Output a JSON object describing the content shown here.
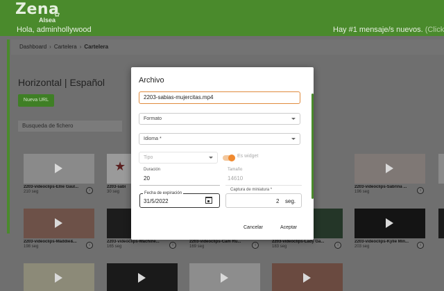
{
  "header": {
    "logo": "Zena",
    "logo_sub": "Alsea",
    "greeting": "Hola, adminhollywood",
    "messages": "Hay #1 mensaje/s nuevos.",
    "messages_hint": "(Click p"
  },
  "breadcrumb": {
    "items": [
      "Dashboard",
      "Cartelera",
      "Cartelera"
    ]
  },
  "page": {
    "title": "Horizontal | Español",
    "new_url_button": "Nueva URL",
    "search_placeholder": "Busqueda de fichero"
  },
  "tiles": [
    {
      "name": "2203-videoclips-Ellie Gaul...",
      "duration": "210 seg"
    },
    {
      "name": "2203-sabi",
      "duration": "30 seg"
    },
    {
      "name": "2203-videoclips-Sabrina ...",
      "duration": "196 seg"
    },
    {
      "name": "2203-videoclips-Maddie&...",
      "duration": "198 seg"
    },
    {
      "name": "2203-videoclips-Machine...",
      "duration": "165 seg"
    },
    {
      "name": "2203-videoclips-Cam Ru...",
      "duration": "169 seg"
    },
    {
      "name": "2203-videoclips-Lady Ga...",
      "duration": "183 seg"
    },
    {
      "name": "2203-videoclips-Kylie Min...",
      "duration": "203 seg"
    }
  ],
  "modal": {
    "title": "Archivo",
    "file_value": "2203-sabias-mujercitas.mp4",
    "format_placeholder": "Formato",
    "language_placeholder": "Idioma *",
    "type_placeholder": "Tipo",
    "widget_label": "Es widget",
    "duration_label": "Duración",
    "duration_value": "20",
    "size_label": "Tamaño",
    "size_value": "14610",
    "expiration_label": "Fecha de expiración",
    "expiration_value": "31/5/2022",
    "thumb_label": "Captura de miniatura *",
    "thumb_value": "2",
    "thumb_unit": "seg.",
    "cancel_label": "Cancelar",
    "accept_label": "Aceptar"
  },
  "colors": {
    "header_bg": "#4a8a2c",
    "accent_orange": "#f08a30"
  }
}
